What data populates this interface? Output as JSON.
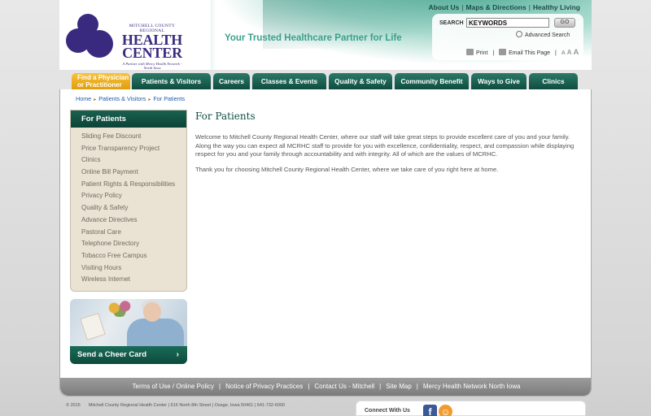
{
  "header": {
    "logo": {
      "small_text": "MITCHELL COUNTY REGIONAL",
      "big_text_1": "HEALTH",
      "big_text_2": "CENTER",
      "tagline": "A Partner with Mercy Health Network - North Iowa"
    },
    "tagline": "Your Trusted Healthcare Partner for Life",
    "top_links": [
      "About Us",
      "Maps & Directions",
      "Healthy Living"
    ],
    "search": {
      "label": "SEARCH",
      "value": "KEYWORDS",
      "go_label": "GO",
      "advanced_label": "Advanced Search"
    },
    "tools": {
      "print_label": "Print",
      "email_label": "Email This Page",
      "text_size": [
        "A",
        "A",
        "A"
      ]
    }
  },
  "nav": {
    "tabs": [
      {
        "label_line1": "Find a Physician",
        "label_line2": "or Practitioner"
      },
      {
        "label": "Patients  & Visitors"
      },
      {
        "label": "Careers"
      },
      {
        "label": "Classes & Events"
      },
      {
        "label": "Quality & Safety"
      },
      {
        "label": "Community Benefit"
      },
      {
        "label": "Ways to Give"
      },
      {
        "label": "Clinics"
      }
    ]
  },
  "breadcrumb": [
    "Home",
    "Patients & Visitors",
    "For Patients"
  ],
  "sidenav": {
    "title": "For Patients",
    "items": [
      "Sliding Fee Discount",
      "Price Transparency Project",
      "Clinics",
      "Online Bill Payment",
      "Patient Rights & Responsibilities",
      "Privacy Policy",
      "Quality & Safety",
      "Advance Directives",
      "Pastoral Care",
      "Telephone Directory",
      "Tobacco Free Campus",
      "Visiting Hours",
      "Wireless Internet"
    ]
  },
  "cheer_card": {
    "label": "Send a Cheer Card",
    "chevron": "›"
  },
  "main": {
    "title": "For Patients",
    "paragraphs": [
      "Welcome to Mitchell County Regional Health Center, where our staff will take great steps to provide excellent care of you and your family. Along the way you can expect all MCRHC staff to provide for you with excellence, confidentiality, respect, and compassion while displaying respect for you and your family through accountability and with integrity. All of which are the values of MCRHC.",
      "Thank you for choosing Mitchell County Regional Health Center, where we take care of you right here at home."
    ]
  },
  "footer": {
    "links": [
      "Terms of Use / Online Policy",
      "Notice of Privacy Practices",
      "Contact Us - Mitchell",
      "Site Map",
      "Mercy Health Network North Iowa"
    ],
    "copyright": "© 2015",
    "address": "Mitchell County Regional Health Center | 616 North 8th Street | Osage, Iowa 50461 | 641-732-6000",
    "connect_label": "Connect With Us",
    "social": [
      {
        "name": "facebook",
        "glyph": "f"
      },
      {
        "name": "rss",
        "glyph": "☺"
      }
    ]
  },
  "colors": {
    "brand_green": "#0f4d40",
    "accent_teal": "#3aa08c",
    "logo_purple": "#3a2a7f",
    "find_tab_gold": "#f2b126",
    "link_blue": "#1f5bb0"
  }
}
